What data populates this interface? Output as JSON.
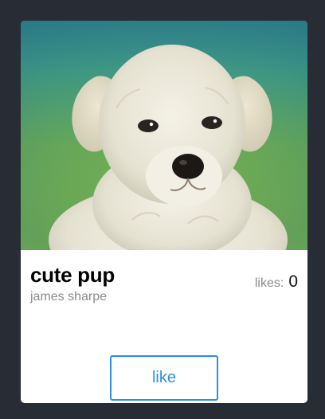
{
  "card": {
    "image_alt": "cute pup",
    "title": "cute pup",
    "author": "james sharpe",
    "likes_label": "likes:",
    "likes_count": 0,
    "like_button_label": "like"
  },
  "colors": {
    "page_background": "#282c35",
    "card_background": "#ffffff",
    "accent": "#2d8ee0",
    "muted_text": "#8a8a8a"
  }
}
